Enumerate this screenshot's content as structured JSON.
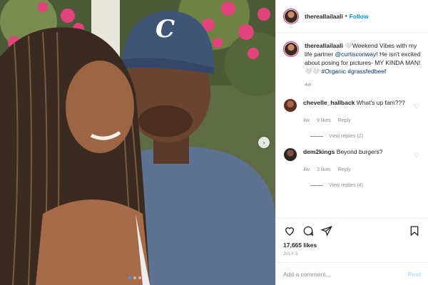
{
  "post": {
    "username": "thereallailaali",
    "separator": "•",
    "follow_label": "Follow"
  },
  "caption": {
    "username": "thereallailaali",
    "text_before": " 🤍Weekend Vibes with my life partner ",
    "mention": "@curtisconway!",
    "text_after": " He isn't excited about posing for pictures- MY KINDA MAN!🤍🤍 ",
    "hashtag1": "#Organic",
    "hashtag2": "#grassfedbeef",
    "time": "4w"
  },
  "comments": [
    {
      "username": "chevelle_hallback",
      "text": "What's up fam???",
      "time": "4w",
      "likes": "9 likes",
      "reply_label": "Reply",
      "view_replies": "View replies (2)"
    },
    {
      "username": "dem2kings",
      "text": "Beyond burgers?",
      "time": "4w",
      "likes": "3 likes",
      "reply_label": "Reply",
      "view_replies": "View replies (4)"
    }
  ],
  "actions": {
    "like_icon": "heart-icon",
    "comment_icon": "comment-icon",
    "share_icon": "share-icon",
    "save_icon": "bookmark-icon"
  },
  "likes_count": "17,665 likes",
  "post_date": "JULY 5",
  "add_comment": {
    "placeholder": "Add a comment...",
    "post_label": "Post"
  },
  "colors": {
    "accent": "#0095f6",
    "post_disabled": "#b2dffc",
    "muted": "#8e8e8e",
    "text": "#262626"
  }
}
